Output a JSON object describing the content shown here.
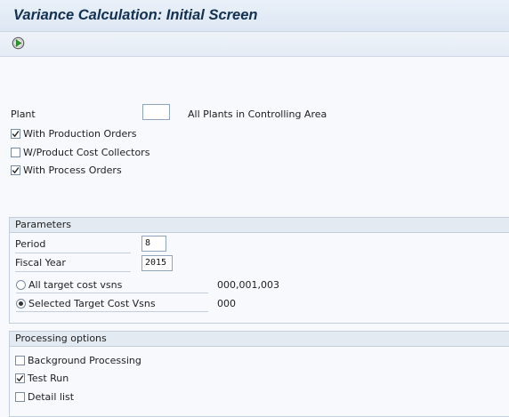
{
  "window": {
    "title": "Variance Calculation: Initial Screen"
  },
  "toolbar": {
    "execute_icon": "execute-clock-icon"
  },
  "selection": {
    "plant_label": "Plant",
    "plant_value": "",
    "plant_hint": "All Plants in Controlling Area",
    "checkboxes": [
      {
        "label": "With Production Orders",
        "checked": true
      },
      {
        "label": "W/Product Cost Collectors",
        "checked": false
      },
      {
        "label": "With Process Orders",
        "checked": true
      }
    ]
  },
  "parameters": {
    "header": "Parameters",
    "period_label": "Period",
    "period_value": "8",
    "fiscal_year_label": "Fiscal Year",
    "fiscal_year_value": "2015",
    "radios": [
      {
        "label": "All target cost vsns",
        "value": "000,001,003",
        "selected": false
      },
      {
        "label": "Selected Target Cost Vsns",
        "value": "000",
        "selected": true
      }
    ]
  },
  "processing": {
    "header": "Processing options",
    "checkboxes": [
      {
        "label": "Background Processing",
        "checked": false
      },
      {
        "label": "Test Run",
        "checked": true
      },
      {
        "label": "Detail list",
        "checked": false
      }
    ]
  }
}
